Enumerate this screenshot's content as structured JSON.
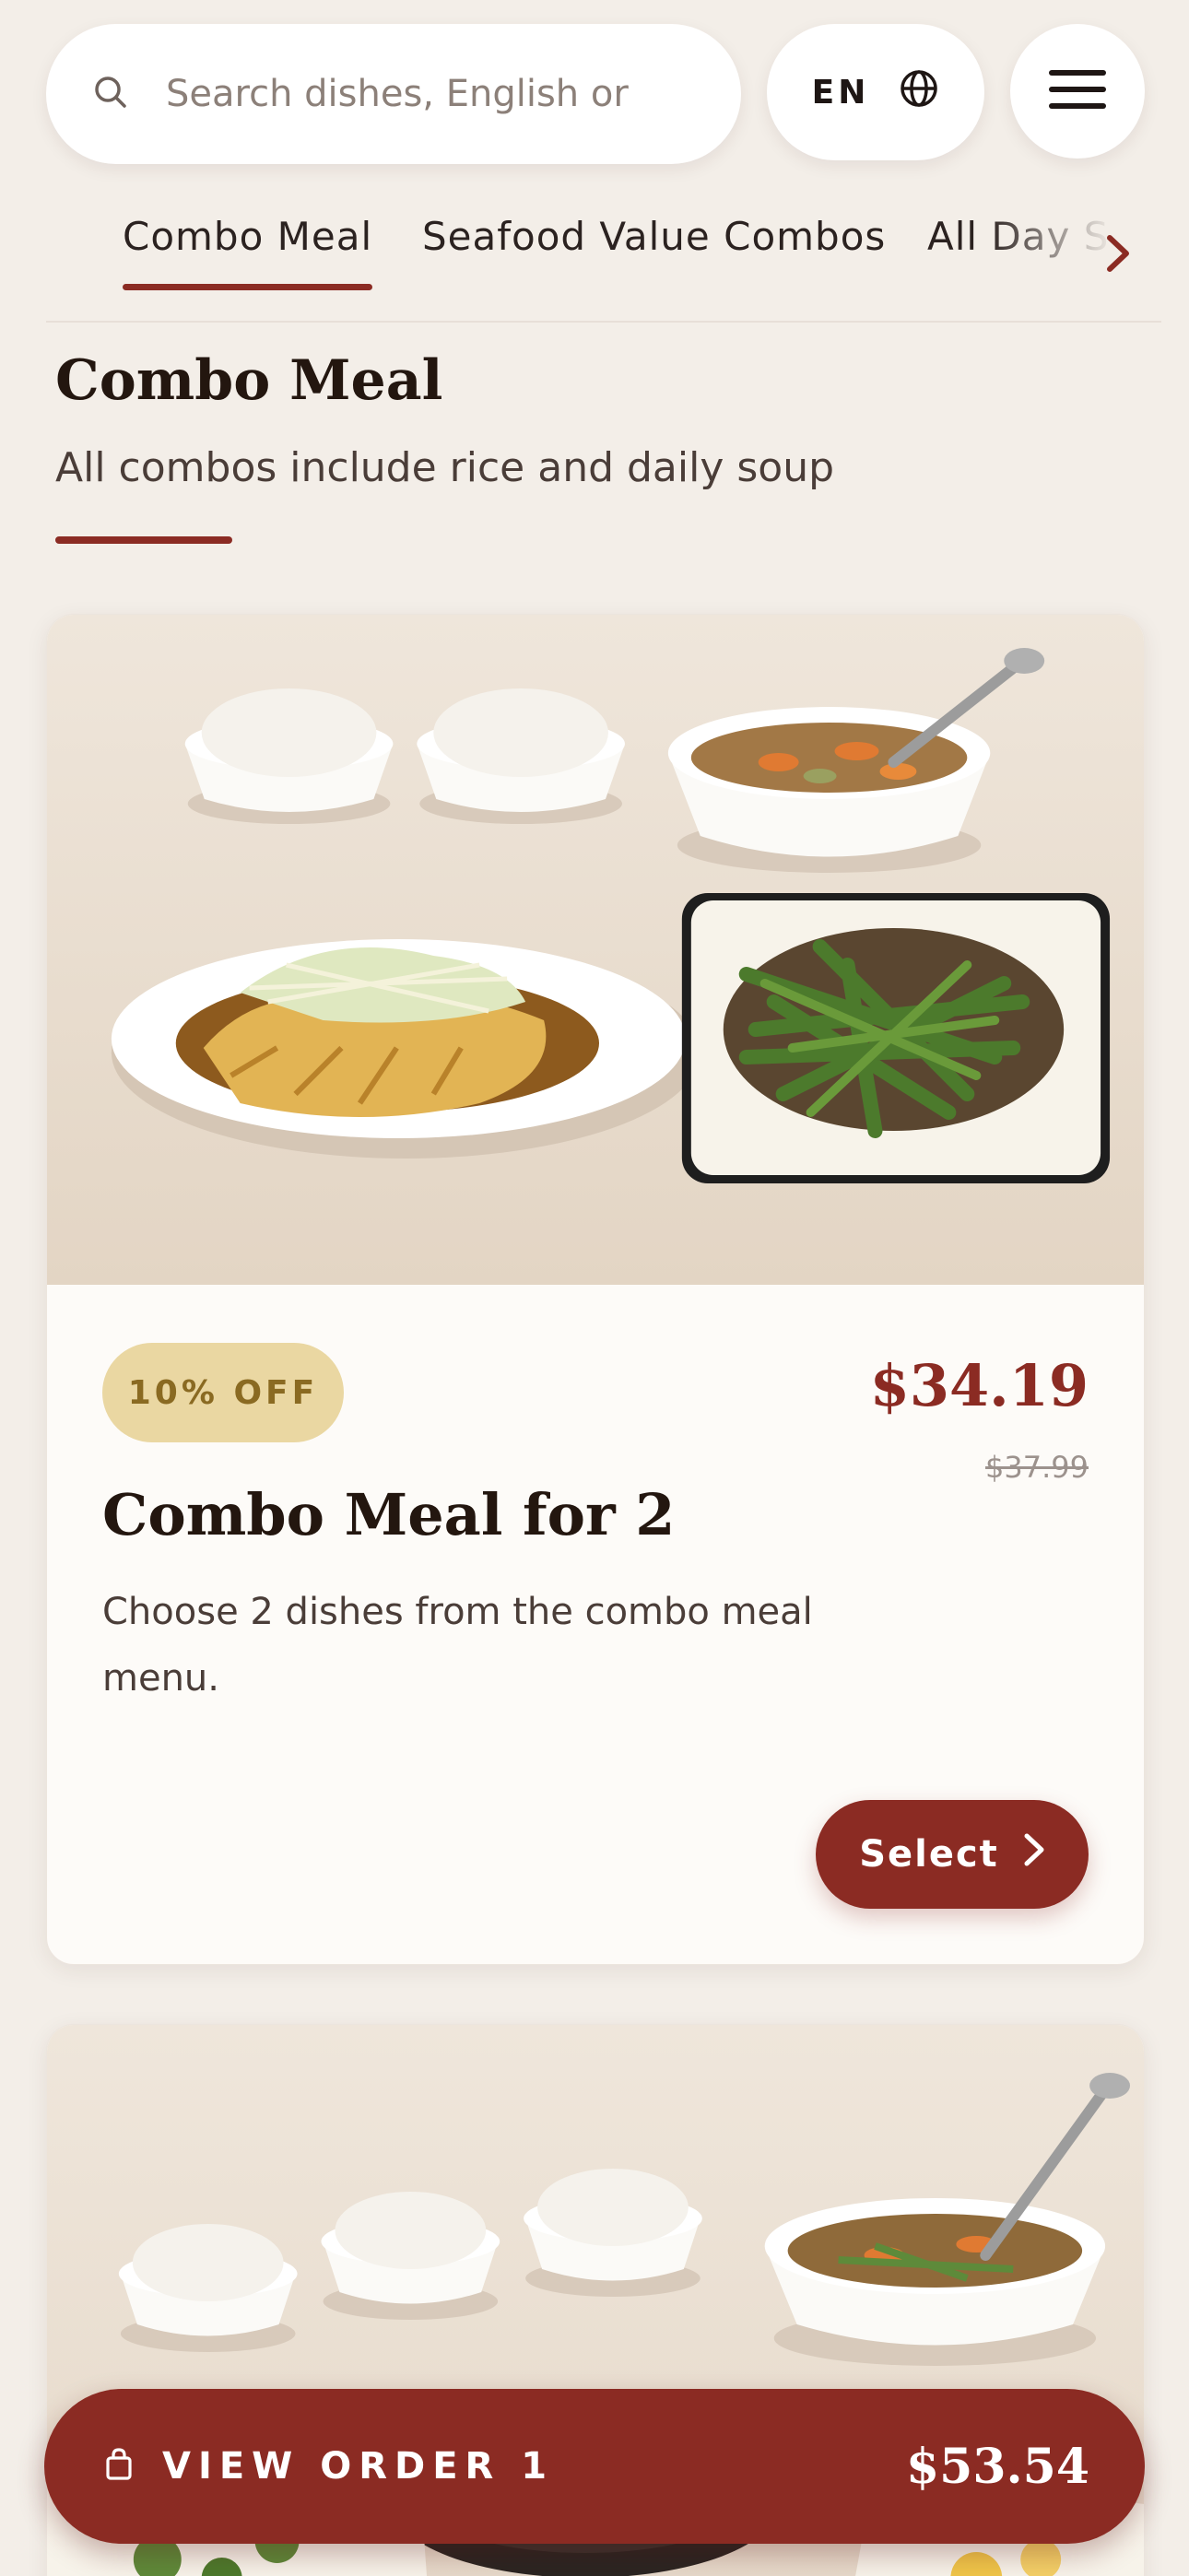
{
  "search": {
    "placeholder": "Search dishes, English or"
  },
  "language": {
    "code": "EN"
  },
  "tabs": [
    {
      "label": "Combo Meal",
      "active": true
    },
    {
      "label": "Seafood Value Combos",
      "active": false
    },
    {
      "label": "All Day S",
      "active": false
    }
  ],
  "section": {
    "title": "Combo Meal",
    "subtitle": "All combos include rice and daily soup"
  },
  "items": [
    {
      "badge": "10% OFF",
      "price": "$34.19",
      "old_price": "$37.99",
      "title": "Combo Meal for 2",
      "description": "Choose 2 dishes from the combo meal menu.",
      "select_label": "Select"
    }
  ],
  "order": {
    "label": "VIEW ORDER 1",
    "total": "$53.54"
  },
  "colors": {
    "accent": "#8b2b23",
    "background": "#f3eee8",
    "badge_bg": "#ead7a2",
    "badge_text": "#8a6a22"
  }
}
